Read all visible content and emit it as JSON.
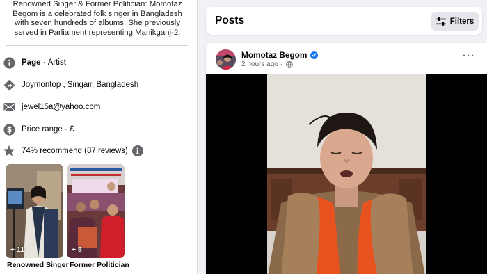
{
  "intro": {
    "bio": "Renowned Singer & Former Politician: Momotaz Begom is a celebrated folk singer in Bangladesh with seven hundreds of albums. She previously served in Parliament representing Manikganj-2.",
    "page_label": "Page",
    "page_separator": " · ",
    "page_category": "Artist",
    "location": "Joymontop , Singair, Bangladesh",
    "email": "jewel15a@yahoo.com",
    "price_range": "Price range · £",
    "recommend": "74% recommend (87 reviews)",
    "info_icon_glyph": "i"
  },
  "albums": [
    {
      "caption": "Renowned Singer",
      "count": "+ 11"
    },
    {
      "caption": "Former Politician",
      "count": "+ 5"
    }
  ],
  "posts": {
    "title": "Posts",
    "filters_label": "Filters"
  },
  "post": {
    "author": "Momotaz Begom",
    "time": "2 hours ago",
    "meta_separator": " · ",
    "more_glyph": "···",
    "audience_icon": "globe-icon"
  },
  "colors": {
    "brand_blue": "#1877f2",
    "secondary_text": "#65676b",
    "page_bg": "#f0f2f5",
    "button_bg": "#e4e6eb"
  }
}
